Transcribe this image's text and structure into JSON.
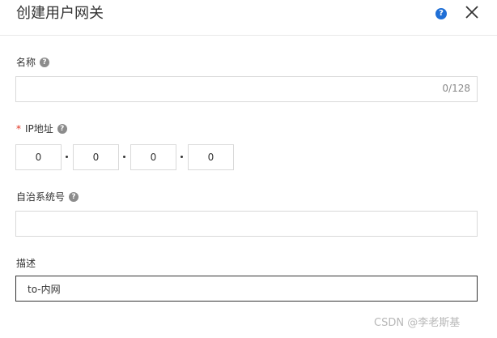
{
  "dialog": {
    "title": "创建用户网关"
  },
  "form": {
    "name": {
      "label": "名称",
      "value": "",
      "counter": "0/128"
    },
    "ip": {
      "required_mark": "*",
      "label": "IP地址",
      "octets": [
        "0",
        "0",
        "0",
        "0"
      ]
    },
    "asn": {
      "label": "自治系统号",
      "value": ""
    },
    "description": {
      "label": "描述",
      "value": "to-内网"
    }
  },
  "icons": {
    "help": "?",
    "close": "×"
  },
  "watermark": "CSDN @李老斯基",
  "colors": {
    "help_blue": "#1f6fd6",
    "required_red": "#e0301e",
    "border": "#d9d9d9"
  }
}
